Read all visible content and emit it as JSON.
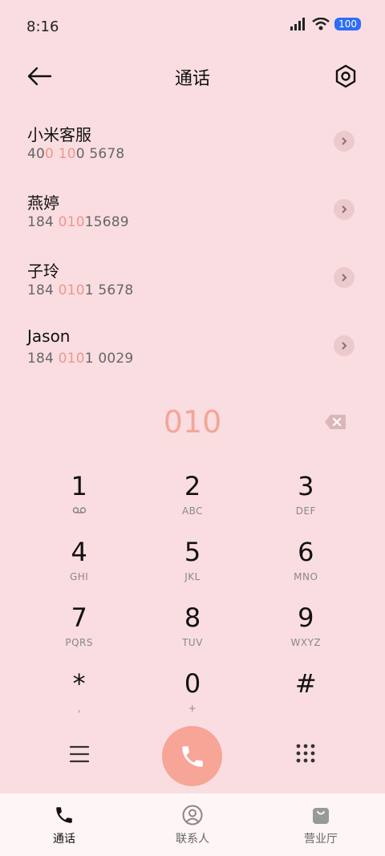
{
  "status": {
    "time": "8:16",
    "battery": "100"
  },
  "header": {
    "title": "通话"
  },
  "results": [
    {
      "name": "小米客服",
      "number": [
        {
          "t": "40",
          "h": false
        },
        {
          "t": "0",
          "h": true
        },
        {
          "t": " ",
          "h": false
        },
        {
          "t": "10",
          "h": true
        },
        {
          "t": "0 5678",
          "h": false
        }
      ]
    },
    {
      "name": "燕婷",
      "number": [
        {
          "t": "184 ",
          "h": false
        },
        {
          "t": "010",
          "h": true
        },
        {
          "t": "15689",
          "h": false
        }
      ]
    },
    {
      "name": "子玲",
      "number": [
        {
          "t": "184 ",
          "h": false
        },
        {
          "t": "010",
          "h": true
        },
        {
          "t": "1 5678",
          "h": false
        }
      ]
    },
    {
      "name": "Jason",
      "number": [
        {
          "t": "184 ",
          "h": false
        },
        {
          "t": "010",
          "h": true
        },
        {
          "t": "1 0029",
          "h": false
        }
      ]
    }
  ],
  "dialer": {
    "number": "010",
    "keys": [
      {
        "digit": "1",
        "sub": "voicemail-icon"
      },
      {
        "digit": "2",
        "sub": "ABC"
      },
      {
        "digit": "3",
        "sub": "DEF"
      },
      {
        "digit": "4",
        "sub": "GHI"
      },
      {
        "digit": "5",
        "sub": "JKL"
      },
      {
        "digit": "6",
        "sub": "MNO"
      },
      {
        "digit": "7",
        "sub": "PQRS"
      },
      {
        "digit": "8",
        "sub": "TUV"
      },
      {
        "digit": "9",
        "sub": "WXYZ"
      },
      {
        "digit": "*",
        "sub": ","
      },
      {
        "digit": "0",
        "sub": "+"
      },
      {
        "digit": "#",
        "sub": ""
      }
    ]
  },
  "nav": {
    "tabs": [
      {
        "label": "通话",
        "icon": "phone-icon",
        "active": true
      },
      {
        "label": "联系人",
        "icon": "contact-icon",
        "active": false
      },
      {
        "label": "营业厅",
        "icon": "store-bag-icon",
        "active": false
      }
    ]
  },
  "colors": {
    "accent": "#f4a597",
    "background": "#fadde1",
    "battery": "#2f6df6"
  }
}
